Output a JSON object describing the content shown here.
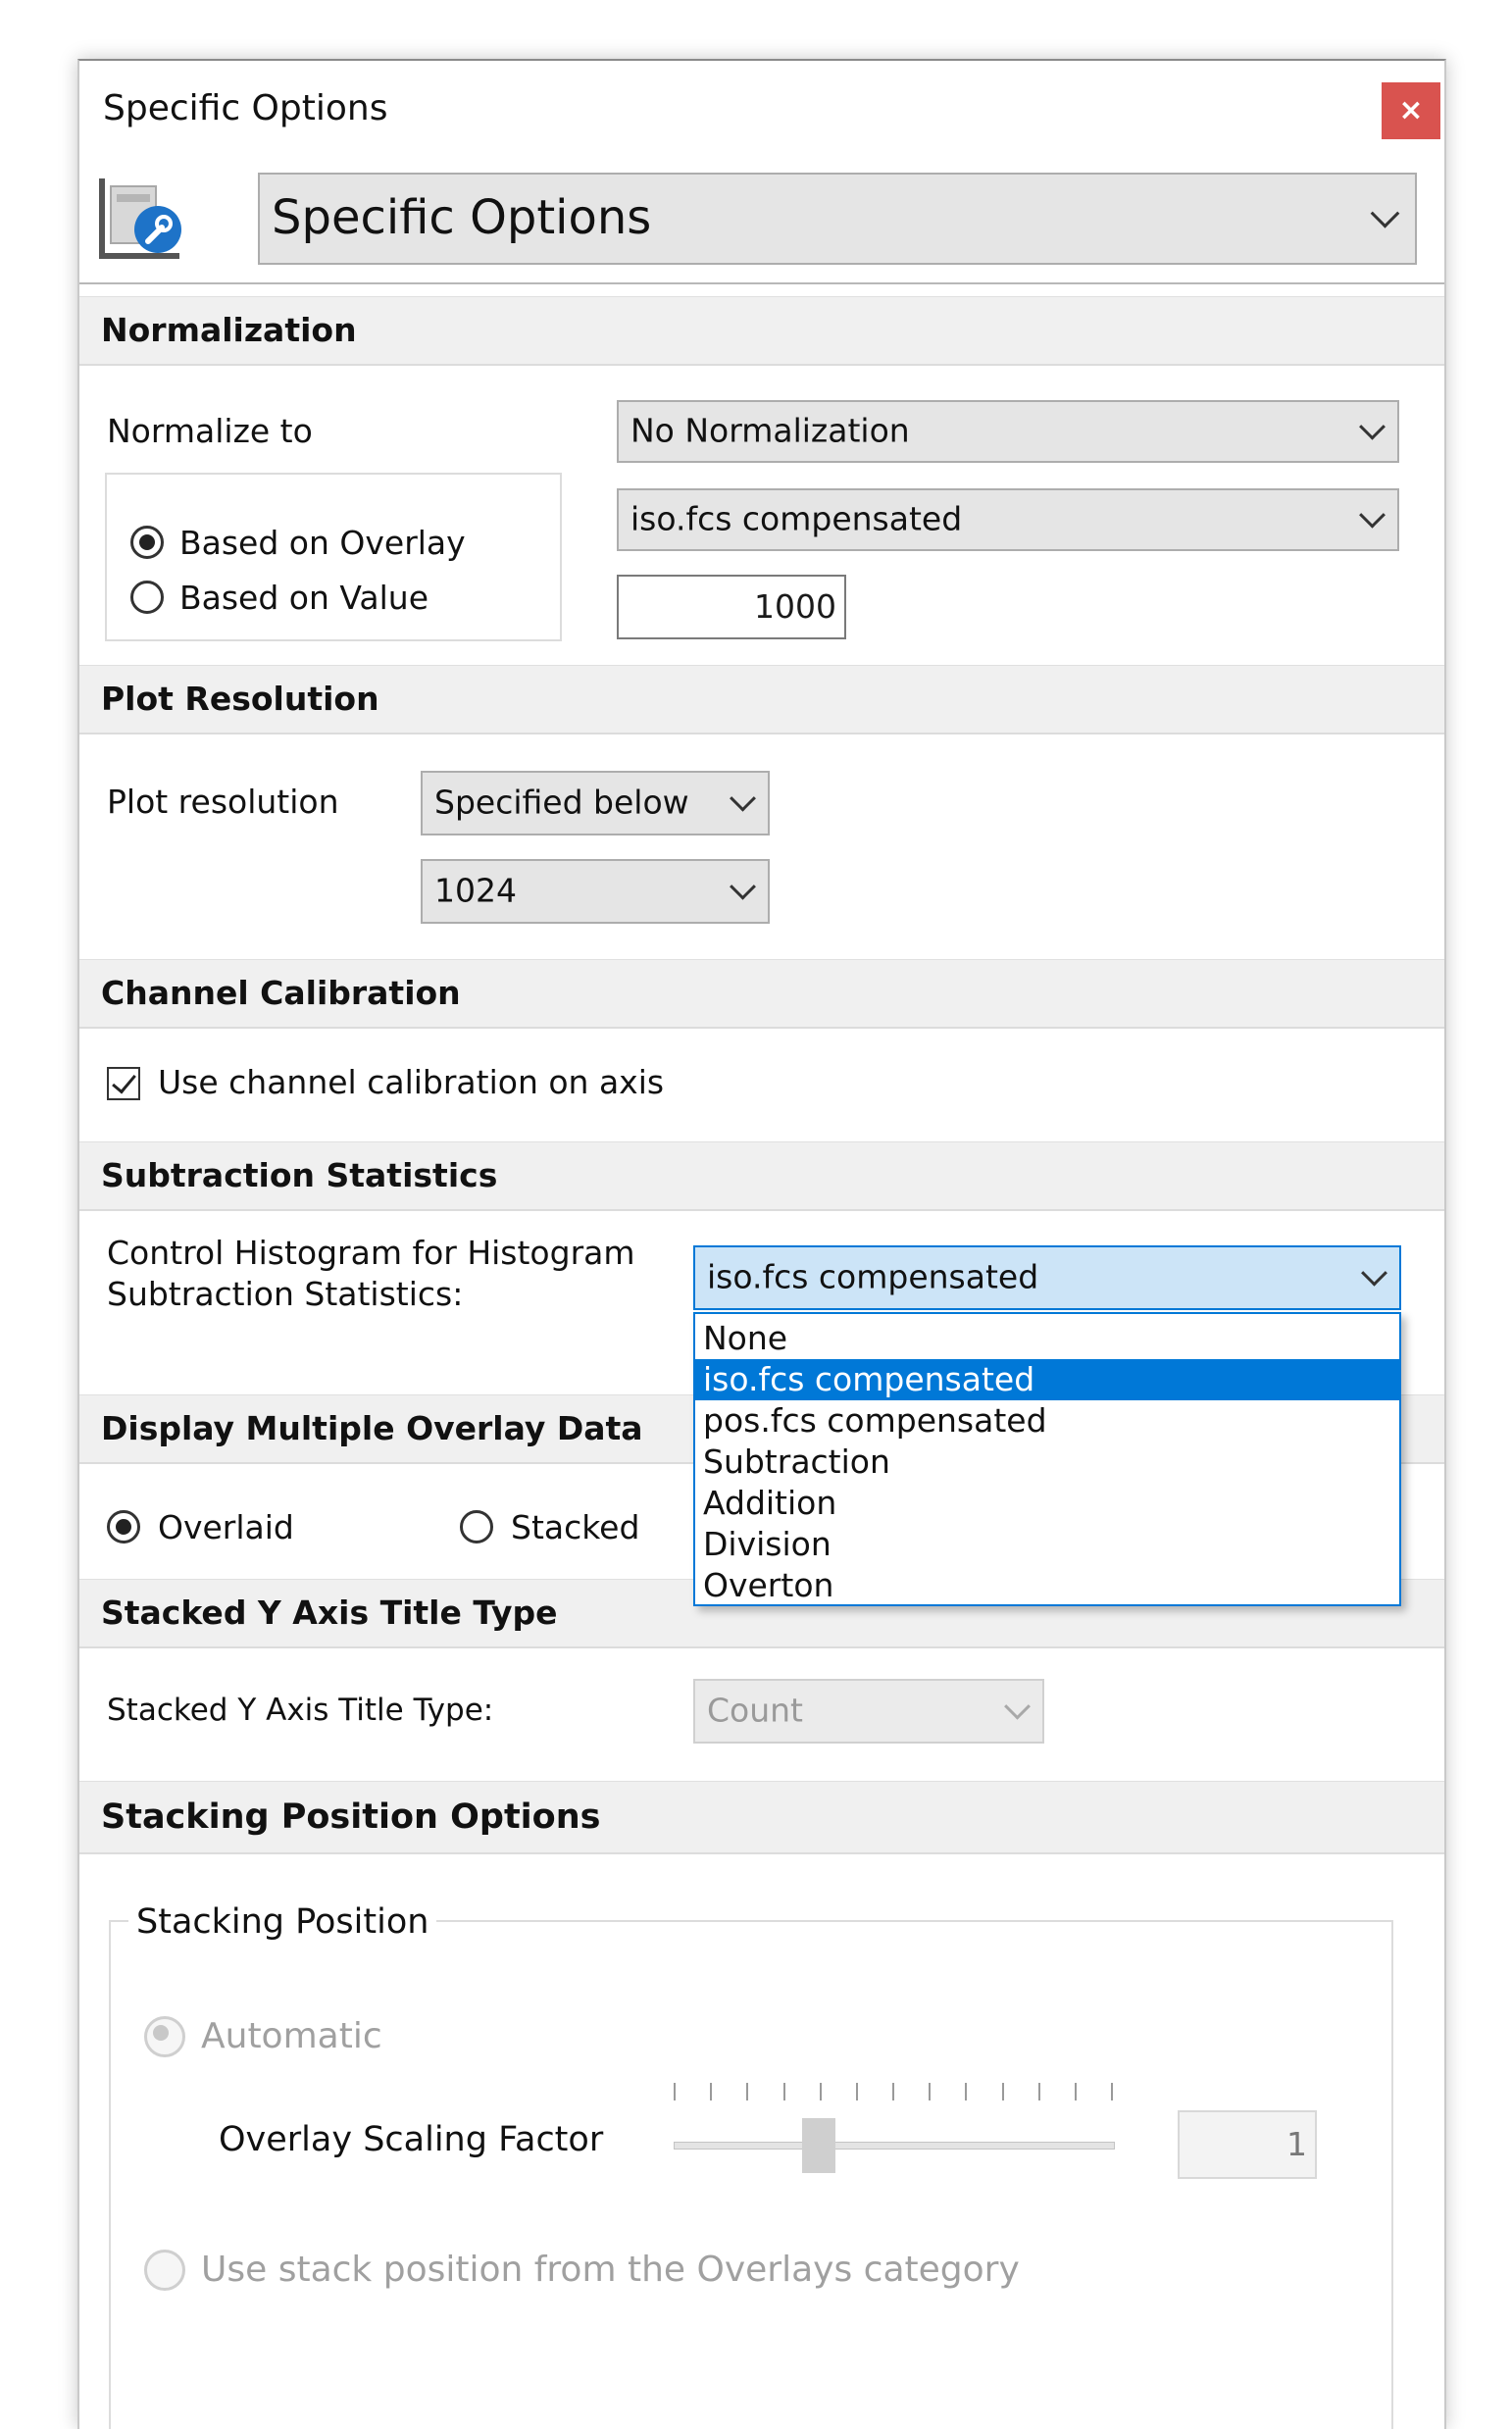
{
  "window": {
    "title": "Specific Options",
    "close_label": "×"
  },
  "header": {
    "category_selected": "Specific Options",
    "icon": "options-wrench-icon"
  },
  "normalization": {
    "section_title": "Normalization",
    "normalize_to_label": "Normalize to",
    "normalize_to_value": "No Normalization",
    "overlay_value": "iso.fcs compensated",
    "value_input": "1000",
    "radio_overlay": "Based on Overlay",
    "radio_value": "Based on Value",
    "selected_radio": "Based on Overlay"
  },
  "plot_resolution": {
    "section_title": "Plot Resolution",
    "label": "Plot resolution",
    "mode_value": "Specified below",
    "size_value": "1024"
  },
  "channel_calibration": {
    "section_title": "Channel Calibration",
    "checkbox_label": "Use channel calibration on axis",
    "checked": true
  },
  "subtraction_statistics": {
    "section_title": "Subtraction Statistics",
    "label_line1": "Control Histogram for Histogram",
    "label_line2": "Subtraction Statistics:",
    "selected_value": "iso.fcs compensated",
    "options": [
      "None",
      "iso.fcs compensated",
      "pos.fcs compensated",
      "Subtraction",
      "Addition",
      "Division",
      "Overton"
    ],
    "highlighted_option": "iso.fcs compensated"
  },
  "display_multiple": {
    "section_title": "Display Multiple Overlay Data",
    "radio_overlaid": "Overlaid",
    "radio_stacked": "Stacked",
    "selected": "Overlaid"
  },
  "stacked_y_axis": {
    "section_title": "Stacked Y Axis Title Type",
    "label": "Stacked Y Axis Title Type:",
    "value": "Count"
  },
  "stacking_position": {
    "section_title": "Stacking Position Options",
    "group_title": "Stacking Position",
    "radio_automatic": "Automatic",
    "scaling_label": "Overlay Scaling Factor",
    "scaling_value": "1",
    "radio_use_overlays": "Use stack position from the Overlays category",
    "slider_fraction": 0.33
  },
  "colors": {
    "accent": "#0078d7",
    "close": "#d9534f",
    "section_bg": "#f0f0f0"
  }
}
